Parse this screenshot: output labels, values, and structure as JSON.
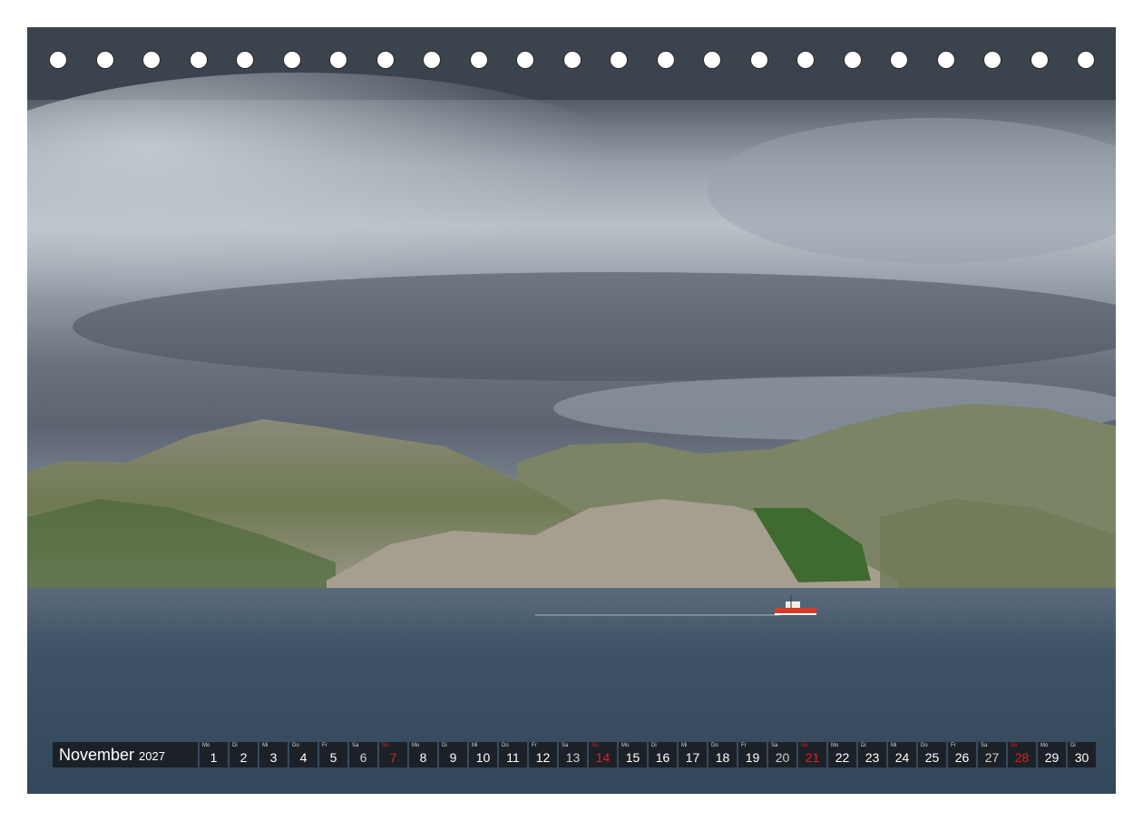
{
  "calendar": {
    "month": "November",
    "year": "2027",
    "days": [
      {
        "n": "1",
        "wd": "Mo",
        "type": "weekday"
      },
      {
        "n": "2",
        "wd": "Di",
        "type": "weekday"
      },
      {
        "n": "3",
        "wd": "Mi",
        "type": "weekday"
      },
      {
        "n": "4",
        "wd": "Do",
        "type": "weekday"
      },
      {
        "n": "5",
        "wd": "Fr",
        "type": "weekday"
      },
      {
        "n": "6",
        "wd": "Sa",
        "type": "sat"
      },
      {
        "n": "7",
        "wd": "So",
        "type": "sun"
      },
      {
        "n": "8",
        "wd": "Mo",
        "type": "weekday"
      },
      {
        "n": "9",
        "wd": "Di",
        "type": "weekday"
      },
      {
        "n": "10",
        "wd": "Mi",
        "type": "weekday"
      },
      {
        "n": "11",
        "wd": "Do",
        "type": "weekday"
      },
      {
        "n": "12",
        "wd": "Fr",
        "type": "weekday"
      },
      {
        "n": "13",
        "wd": "Sa",
        "type": "sat"
      },
      {
        "n": "14",
        "wd": "So",
        "type": "sun"
      },
      {
        "n": "15",
        "wd": "Mo",
        "type": "weekday"
      },
      {
        "n": "16",
        "wd": "Di",
        "type": "weekday"
      },
      {
        "n": "17",
        "wd": "Mi",
        "type": "weekday"
      },
      {
        "n": "18",
        "wd": "Do",
        "type": "weekday"
      },
      {
        "n": "19",
        "wd": "Fr",
        "type": "weekday"
      },
      {
        "n": "20",
        "wd": "Sa",
        "type": "sat"
      },
      {
        "n": "21",
        "wd": "So",
        "type": "sun"
      },
      {
        "n": "22",
        "wd": "Mo",
        "type": "weekday"
      },
      {
        "n": "23",
        "wd": "Di",
        "type": "weekday"
      },
      {
        "n": "24",
        "wd": "Mi",
        "type": "weekday"
      },
      {
        "n": "25",
        "wd": "Do",
        "type": "weekday"
      },
      {
        "n": "26",
        "wd": "Fr",
        "type": "weekday"
      },
      {
        "n": "27",
        "wd": "Sa",
        "type": "sat"
      },
      {
        "n": "28",
        "wd": "So",
        "type": "sun"
      },
      {
        "n": "29",
        "wd": "Mo",
        "type": "weekday"
      },
      {
        "n": "30",
        "wd": "Di",
        "type": "weekday"
      }
    ]
  },
  "binding_holes": 23,
  "colors": {
    "sunday": "#e02020",
    "bar": "#14161a"
  }
}
